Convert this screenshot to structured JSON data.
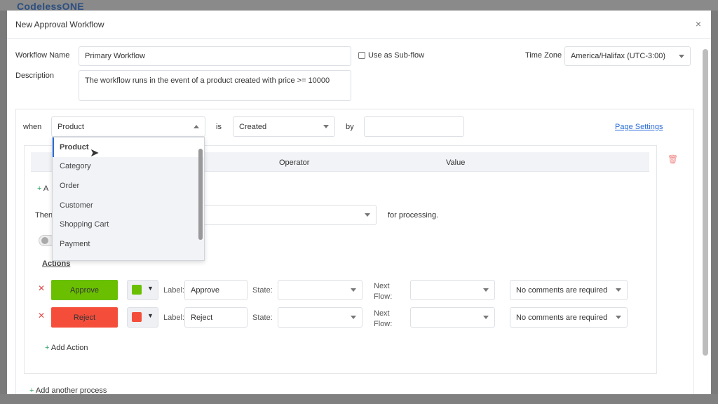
{
  "background": {
    "app_title": "CodelessONE"
  },
  "modal": {
    "title": "New Approval Workflow",
    "close": "×"
  },
  "form": {
    "workflow_name_label": "Workflow Name",
    "workflow_name": "Primary Workflow",
    "subflow_label": "Use as Sub-flow",
    "subflow_checked": false,
    "timezone_label": "Time Zone",
    "timezone": "America/Halifax (UTC-3:00)",
    "description_label": "Description",
    "description": "The workflow runs in the event of a product created with price >= 10000"
  },
  "trigger": {
    "when_label": "when",
    "entity": "Product",
    "is_label": "is",
    "event": "Created",
    "by_label": "by",
    "by_value": "",
    "page_settings": "Page Settings"
  },
  "dropdown": {
    "options": [
      "Product",
      "Category",
      "Order",
      "Customer",
      "Shopping Cart",
      "Payment"
    ],
    "selected": "Product"
  },
  "conditions": {
    "headers": [
      "Operator",
      "Value"
    ],
    "add_prefix": "A",
    "then_prefix": "Then",
    "for_processing": "for processing."
  },
  "actions": {
    "heading": "Actions",
    "items": [
      {
        "button": "Approve",
        "color": "#6abf00",
        "label_text": "Label:",
        "label": "Approve",
        "state_label": "State:",
        "state": "",
        "next_flow_label": "Next Flow:",
        "comments": "No comments are required"
      },
      {
        "button": "Reject",
        "color": "#f44e3b",
        "label_text": "Label:",
        "label": "Reject",
        "state_label": "State:",
        "state": "",
        "next_flow_label": "Next Flow:",
        "comments": "No comments are required"
      }
    ],
    "add_action": "Add Action"
  },
  "add_process": "Add another process"
}
